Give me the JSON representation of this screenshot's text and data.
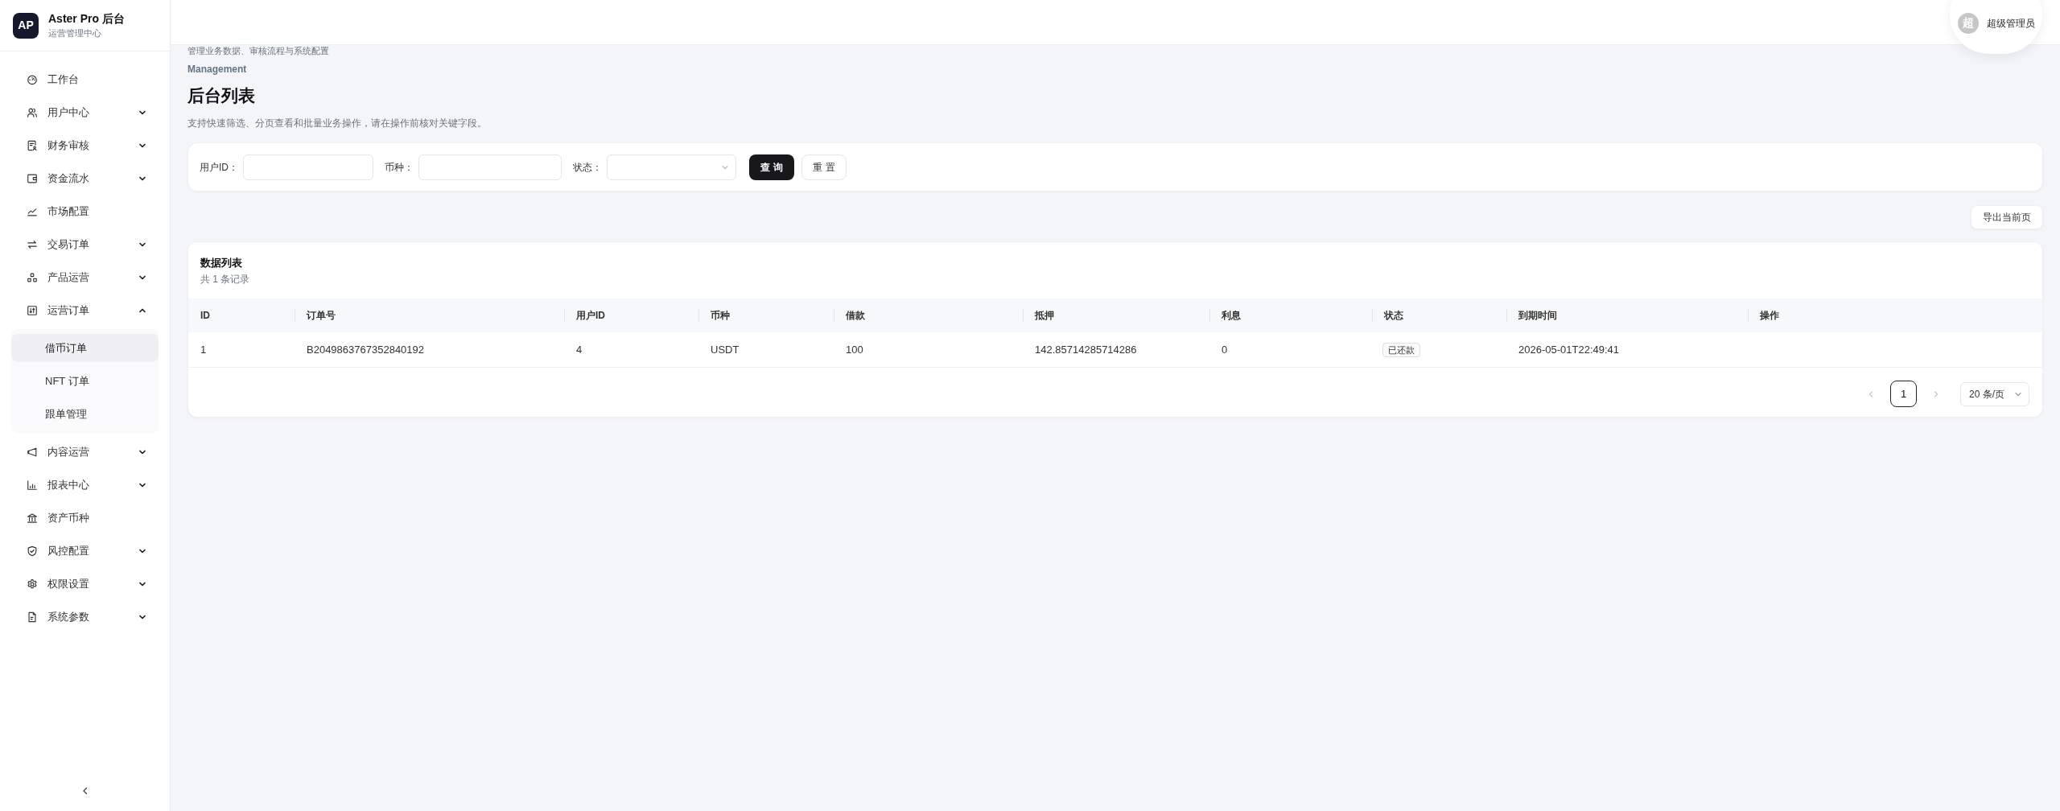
{
  "sidebar": {
    "logo": "AP",
    "title": "Aster Pro 后台",
    "subtitle": "运营管理中心",
    "items": [
      {
        "label": "工作台",
        "kind": "link",
        "selected": false
      },
      {
        "label": "用户中心",
        "kind": "group",
        "selected": false,
        "expanded": false
      },
      {
        "label": "财务审核",
        "kind": "group",
        "selected": false,
        "expanded": false
      },
      {
        "label": "资金流水",
        "kind": "group",
        "selected": false,
        "expanded": false
      },
      {
        "label": "市场配置",
        "kind": "link",
        "selected": false
      },
      {
        "label": "交易订单",
        "kind": "group",
        "selected": false,
        "expanded": false
      },
      {
        "label": "产品运营",
        "kind": "group",
        "selected": false,
        "expanded": false
      },
      {
        "label": "运营订单",
        "kind": "group",
        "selected": false,
        "expanded": true,
        "children": [
          {
            "label": "借币订单",
            "selected": true
          },
          {
            "label": "NFT 订单",
            "selected": false
          },
          {
            "label": "跟单管理",
            "selected": false
          }
        ]
      },
      {
        "label": "内容运营",
        "kind": "group",
        "selected": false,
        "expanded": false
      },
      {
        "label": "报表中心",
        "kind": "group",
        "selected": false,
        "expanded": false
      },
      {
        "label": "资产币种",
        "kind": "link",
        "selected": false
      },
      {
        "label": "风控配置",
        "kind": "group",
        "selected": false,
        "expanded": false
      },
      {
        "label": "权限设置",
        "kind": "group",
        "selected": false,
        "expanded": false
      },
      {
        "label": "系统参数",
        "kind": "group",
        "selected": false,
        "expanded": false
      }
    ]
  },
  "header": {
    "subtitle": "管理业务数据、审核流程与系统配置",
    "user": {
      "avatar": "超",
      "name": "超级管理员"
    }
  },
  "page": {
    "eyebrow": "Management",
    "title": "后台列表",
    "description": "支持快速筛选、分页查看和批量业务操作，请在操作前核对关键字段。"
  },
  "filters": {
    "fields": [
      {
        "kind": "input",
        "label": "用户ID："
      },
      {
        "kind": "input",
        "label": "币种："
      },
      {
        "kind": "select",
        "label": "状态："
      }
    ],
    "buttons": [
      {
        "kind": "primary",
        "label": "查 询"
      },
      {
        "kind": "default",
        "label": "重 置"
      }
    ]
  },
  "toolbar": {
    "export_button": "导出当前页"
  },
  "table": {
    "title": "数据列表",
    "count": "共 1 条记录",
    "columns": [
      "ID",
      "订单号",
      "用户ID",
      "币种",
      "借款",
      "抵押",
      "利息",
      "状态",
      "到期时间",
      "操作"
    ],
    "rows": [
      {
        "id": "1",
        "order_no": "B2049863767352840192",
        "user_id": "4",
        "currency": "USDT",
        "loan": "100",
        "collateral": "142.85714285714286",
        "interest": "0",
        "status": "已还款",
        "due_time": "2026-05-01T22:49:41"
      }
    ]
  },
  "pagination": {
    "prev": {
      "disabled": true
    },
    "pages": [
      {
        "label": "1",
        "selected": true
      }
    ],
    "next": {
      "disabled": true
    },
    "page_size": "20 条/页"
  }
}
